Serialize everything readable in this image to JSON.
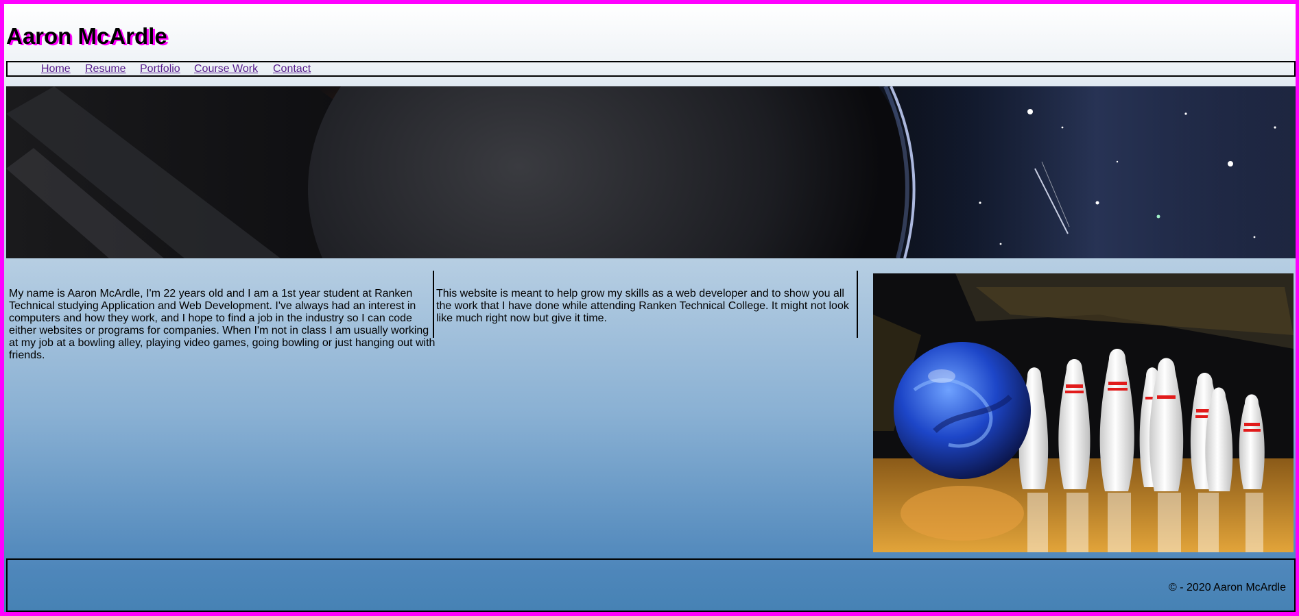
{
  "header": {
    "title": "Aaron McArdle"
  },
  "nav": {
    "items": [
      {
        "label": "Home"
      },
      {
        "label": "Resume"
      },
      {
        "label": "Portfolio"
      },
      {
        "label": "Course Work"
      },
      {
        "label": "Contact"
      }
    ]
  },
  "main": {
    "about_text": "My name is Aaron McArdle, I'm 22 years old and I am a 1st year student at Ranken Technical studying Application and Web Development. I've always had an interest in computers and how they work, and I hope to find a job in the industry so I can code either websites or programs for companies. When I'm not in class I am usually working at my job at a bowling alley, playing video games, going bowling or just hanging out with friends.",
    "purpose_text": "This website is meant to help grow my skills as a web developer and to show you all the work that I have done while attending Ranken Technical College. It might not look like much right now but give it time."
  },
  "footer": {
    "copyright": "© - 2020 Aaron McArdle"
  },
  "colors": {
    "frame": "#ff00ff",
    "gradient_bottom": "#4682b4",
    "link": "#551a8b"
  }
}
